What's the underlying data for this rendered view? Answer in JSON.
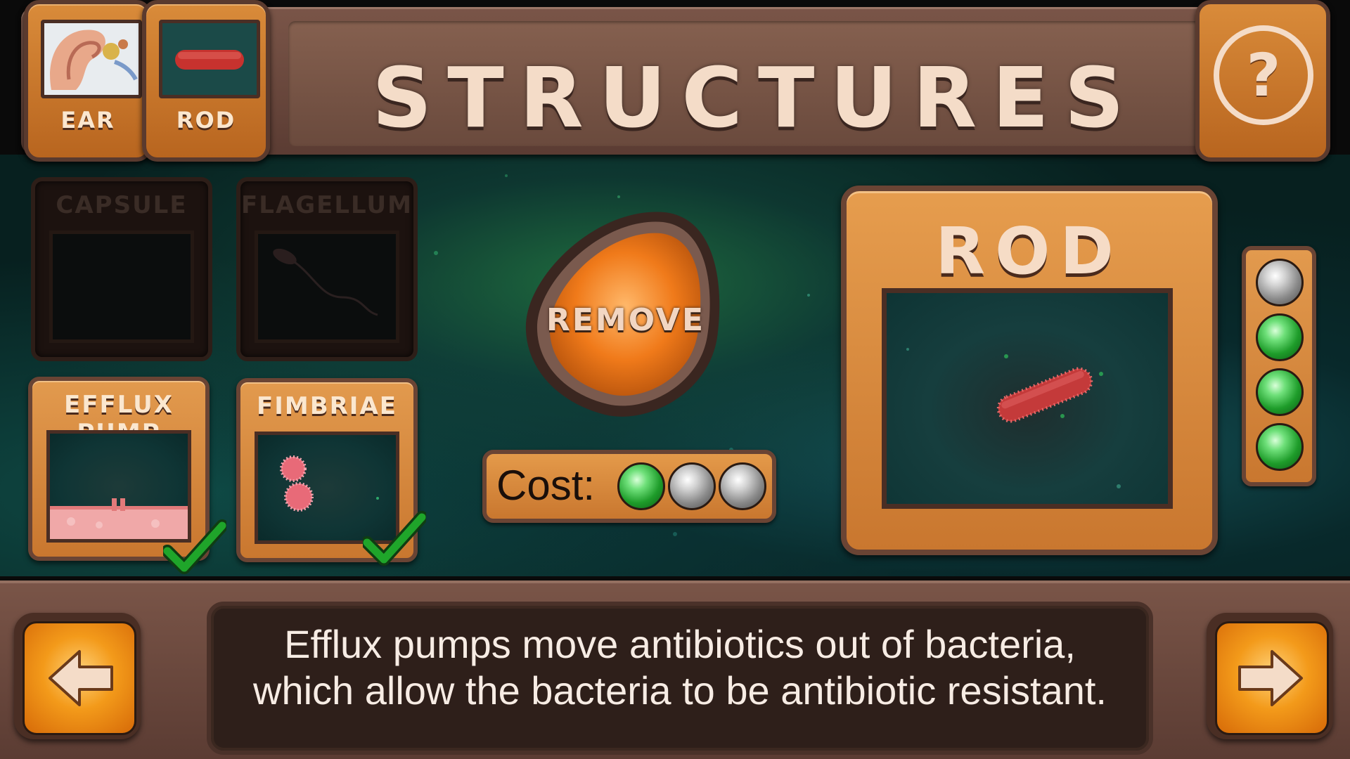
{
  "header": {
    "title": "STRUCTURES",
    "tabs": [
      {
        "label": "EAR"
      },
      {
        "label": "ROD"
      }
    ],
    "help_icon": "question-mark-icon"
  },
  "structures": [
    {
      "label": "CAPSULE",
      "state": "locked"
    },
    {
      "label": "FLAGELLUM",
      "state": "locked"
    },
    {
      "label": "EFFLUX PUMP",
      "state": "unlocked",
      "checked": true
    },
    {
      "label": "FIMBRIAE",
      "state": "unlocked",
      "checked": true
    }
  ],
  "remove_button": {
    "label": "REMOVE"
  },
  "cost": {
    "label": "Cost:",
    "orbs": [
      "green",
      "grey",
      "grey"
    ]
  },
  "preview": {
    "title": "ROD"
  },
  "level_lights": [
    "grey",
    "green",
    "green",
    "green"
  ],
  "description": {
    "line1": "Efflux pumps move antibiotics out of bacteria,",
    "line2": "which allow the bacteria to be antibiotic resistant."
  },
  "nav": {
    "prev_icon": "arrow-left-icon",
    "next_icon": "arrow-right-icon"
  },
  "colors": {
    "panel_orange": "#c9772f",
    "frame_brown": "#6a4434",
    "text_cream": "#f4dcc8",
    "check_green": "#1fa52a"
  }
}
